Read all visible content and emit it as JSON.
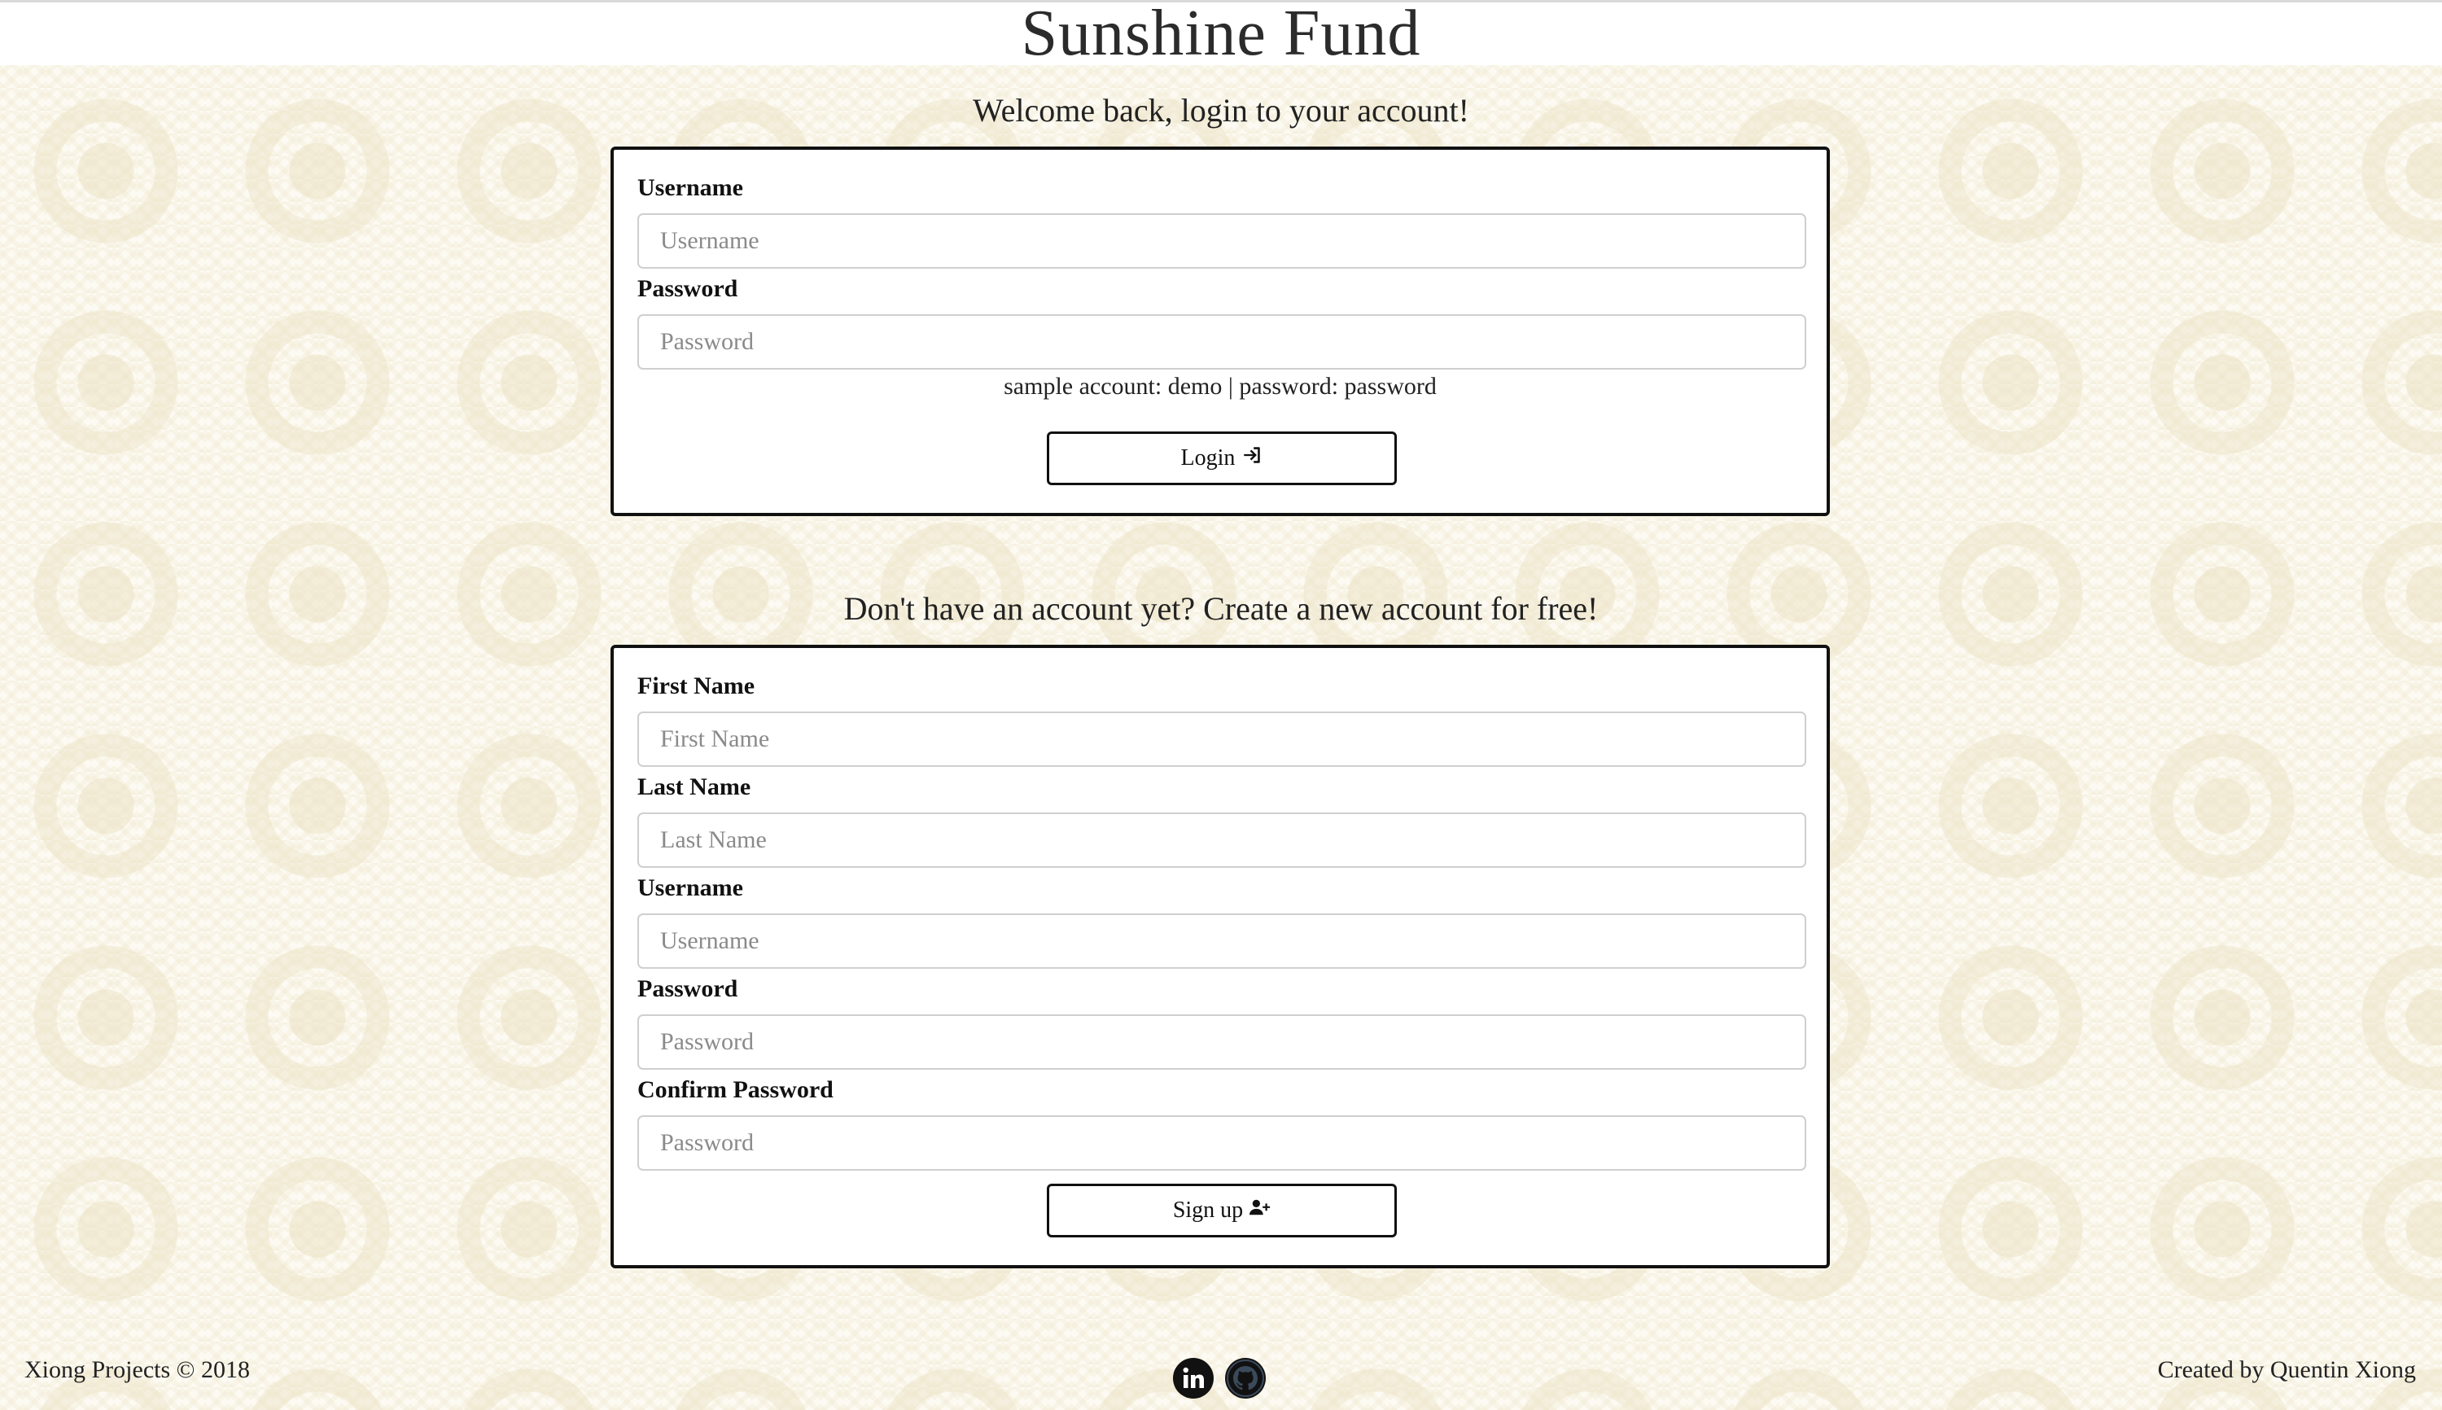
{
  "header": {
    "title": "Sunshine Fund"
  },
  "login": {
    "heading": "Welcome back, login to your account!",
    "username_label": "Username",
    "username_placeholder": "Username",
    "password_label": "Password",
    "password_placeholder": "Password",
    "hint": "sample account: demo | password: password",
    "button_label": "Login",
    "button_icon": "sign-in-icon"
  },
  "signup": {
    "heading": "Don't have an account yet? Create a new account for free!",
    "first_name_label": "First Name",
    "first_name_placeholder": "First Name",
    "last_name_label": "Last Name",
    "last_name_placeholder": "Last Name",
    "username_label": "Username",
    "username_placeholder": "Username",
    "password_label": "Password",
    "password_placeholder": "Password",
    "confirm_label": "Confirm Password",
    "confirm_placeholder": "Password",
    "button_label": "Sign up",
    "button_icon": "user-plus-icon"
  },
  "footer": {
    "left": "Xiong Projects © 2018",
    "right": "Created by Quentin Xiong",
    "icons": [
      "linkedin-icon",
      "github-icon"
    ]
  },
  "colors": {
    "background": "#fcfaf2",
    "pattern": "#ece2c4",
    "border": "#111111",
    "text": "#222222"
  }
}
